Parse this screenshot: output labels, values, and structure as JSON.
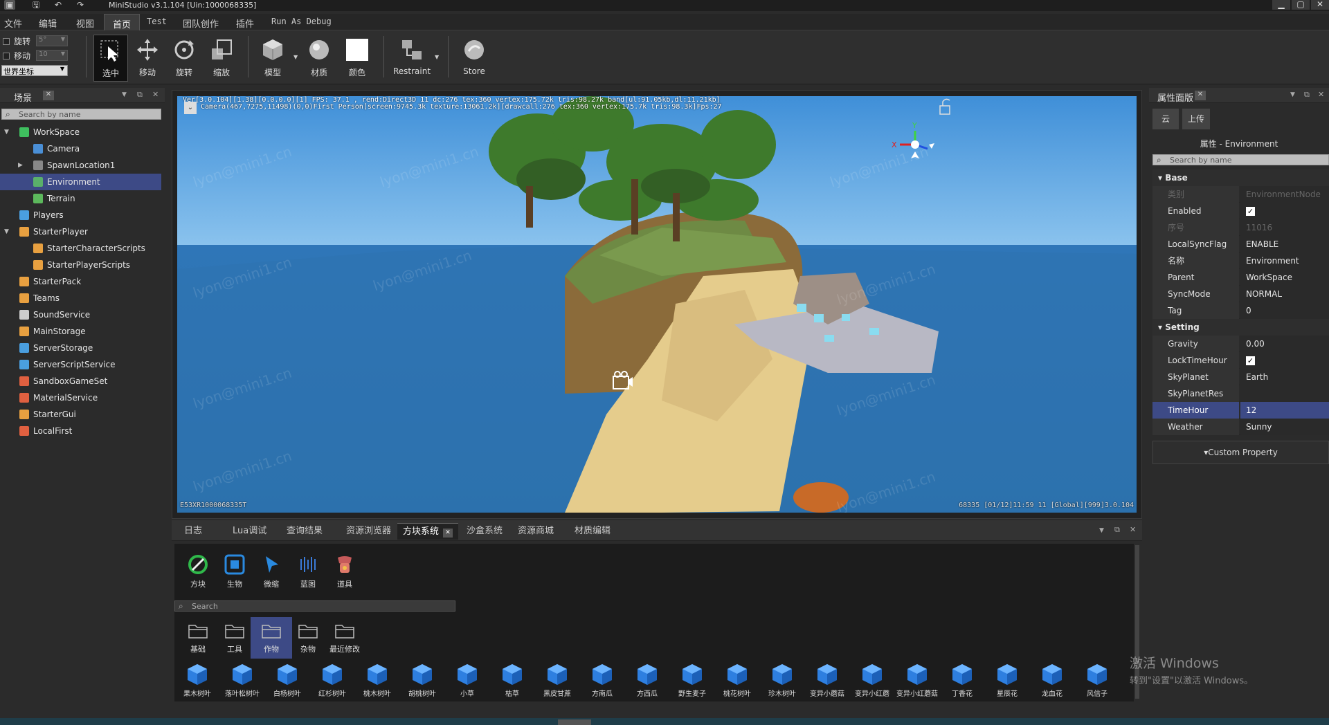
{
  "titlebar": {
    "title": "MiniStudio v3.1.104 [Uin:1000068335]"
  },
  "menu": [
    "文件",
    "编辑",
    "视图",
    "首页",
    "Test",
    "团队创作",
    "插件",
    "Run As Debug"
  ],
  "toolbar": {
    "rotate_label": "旋转",
    "rotate_value": "5°",
    "move_label": "移动",
    "move_value": "10",
    "coord_value": "世界坐标",
    "tools": [
      "选中",
      "移动",
      "旋转",
      "缩放",
      "模型",
      "材质",
      "颜色",
      "Restraint",
      "Store"
    ]
  },
  "scene": {
    "title": "场景",
    "search_placeholder": "Search by name",
    "items": [
      {
        "label": "WorkSpace",
        "color": "#3fbf5f"
      },
      {
        "label": "Camera",
        "color": "#4a8fd6"
      },
      {
        "label": "SpawnLocation1",
        "color": "#888888"
      },
      {
        "label": "Environment",
        "color": "#5ab06a"
      },
      {
        "label": "Terrain",
        "color": "#5cb85c"
      },
      {
        "label": "Players",
        "color": "#4a9fe0"
      },
      {
        "label": "StarterPlayer",
        "color": "#e8a040"
      },
      {
        "label": "StarterCharacterScripts",
        "color": "#e8a040"
      },
      {
        "label": "StarterPlayerScripts",
        "color": "#e8a040"
      },
      {
        "label": "StarterPack",
        "color": "#e8a040"
      },
      {
        "label": "Teams",
        "color": "#e8a040"
      },
      {
        "label": "SoundService",
        "color": "#cccccc"
      },
      {
        "label": "MainStorage",
        "color": "#e8a040"
      },
      {
        "label": "ServerStorage",
        "color": "#4a9fe0"
      },
      {
        "label": "ServerScriptService",
        "color": "#4a9fe0"
      },
      {
        "label": "SandboxGameSet",
        "color": "#e06040"
      },
      {
        "label": "MaterialService",
        "color": "#e06040"
      },
      {
        "label": "StarterGui",
        "color": "#e8a040"
      },
      {
        "label": "LocalFirst",
        "color": "#e06040"
      }
    ]
  },
  "viewport": {
    "info_line1": "Ver[3.0.104][1.38][0.0.0.0][1] FPS: 37.1 , rend:Direct3D 11 dc:276 tex:360 vertex:175.72k tris:98.27k band[ul:91.05kb,dl:11.21kb]",
    "info_line2": "Camera(467,7275,11498)(0,0)First Person[screen:9745.3k texture:13061.2k][drawcall:276 tex:360 vertex:175.7k tris:98.3k]Fps:27",
    "bottom_left": "E53XR1000068335T",
    "bottom_right": "68335   [01/12]11:59 11  [Global][999]3.0.104",
    "watermark": "lyon@mini1.cn"
  },
  "props": {
    "title": "属性面版",
    "btn_cloud": "云",
    "btn_upload": "上传",
    "subtitle": "属性 - Environment",
    "search_placeholder": "Search by name",
    "section_base": "Base",
    "section_setting": "Setting",
    "base": [
      {
        "k": "类别",
        "v": "EnvironmentNode"
      },
      {
        "k": "Enabled",
        "v": "✓"
      },
      {
        "k": "序号",
        "v": "11016"
      },
      {
        "k": "LocalSyncFlag",
        "v": "ENABLE"
      },
      {
        "k": "名称",
        "v": "Environment"
      },
      {
        "k": "Parent",
        "v": "WorkSpace"
      },
      {
        "k": "SyncMode",
        "v": "NORMAL"
      },
      {
        "k": "Tag",
        "v": "0"
      }
    ],
    "setting": [
      {
        "k": "Gravity",
        "v": "0.00"
      },
      {
        "k": "LockTimeHour",
        "v": "✓"
      },
      {
        "k": "SkyPlanet",
        "v": "Earth"
      },
      {
        "k": "SkyPlanetRes",
        "v": ""
      },
      {
        "k": "TimeHour",
        "v": "12"
      },
      {
        "k": "Weather",
        "v": "Sunny"
      }
    ],
    "custom": "▾Custom Property"
  },
  "bottom": {
    "tabs": [
      "日志",
      "Lua调试",
      "查询结果",
      "资源浏览器",
      "方块系统",
      "沙盒系统",
      "资源商城",
      "材质编辑"
    ],
    "categories": [
      "方块",
      "生物",
      "微缩",
      "蓝图",
      "道具"
    ],
    "search_placeholder": "Search",
    "folders": [
      "基础",
      "工具",
      "作物",
      "杂物",
      "最近修改"
    ],
    "blocks": [
      "果木树叶",
      "落叶松树叶",
      "白杨树叶",
      "红杉树叶",
      "桃木树叶",
      "胡桃树叶",
      "小草",
      "枯草",
      "黑皮甘蔗",
      "方南瓜",
      "方西瓜",
      "野生麦子",
      "桃花树叶",
      "珍木树叶",
      "变异小蘑菇",
      "变异小红蘑",
      "变异小红蘑菇",
      "丁香花",
      "星辰花",
      "龙血花",
      "风信子"
    ]
  },
  "activate": {
    "line1": "激活 Windows",
    "line2": "转到\"设置\"以激活 Windows。"
  }
}
